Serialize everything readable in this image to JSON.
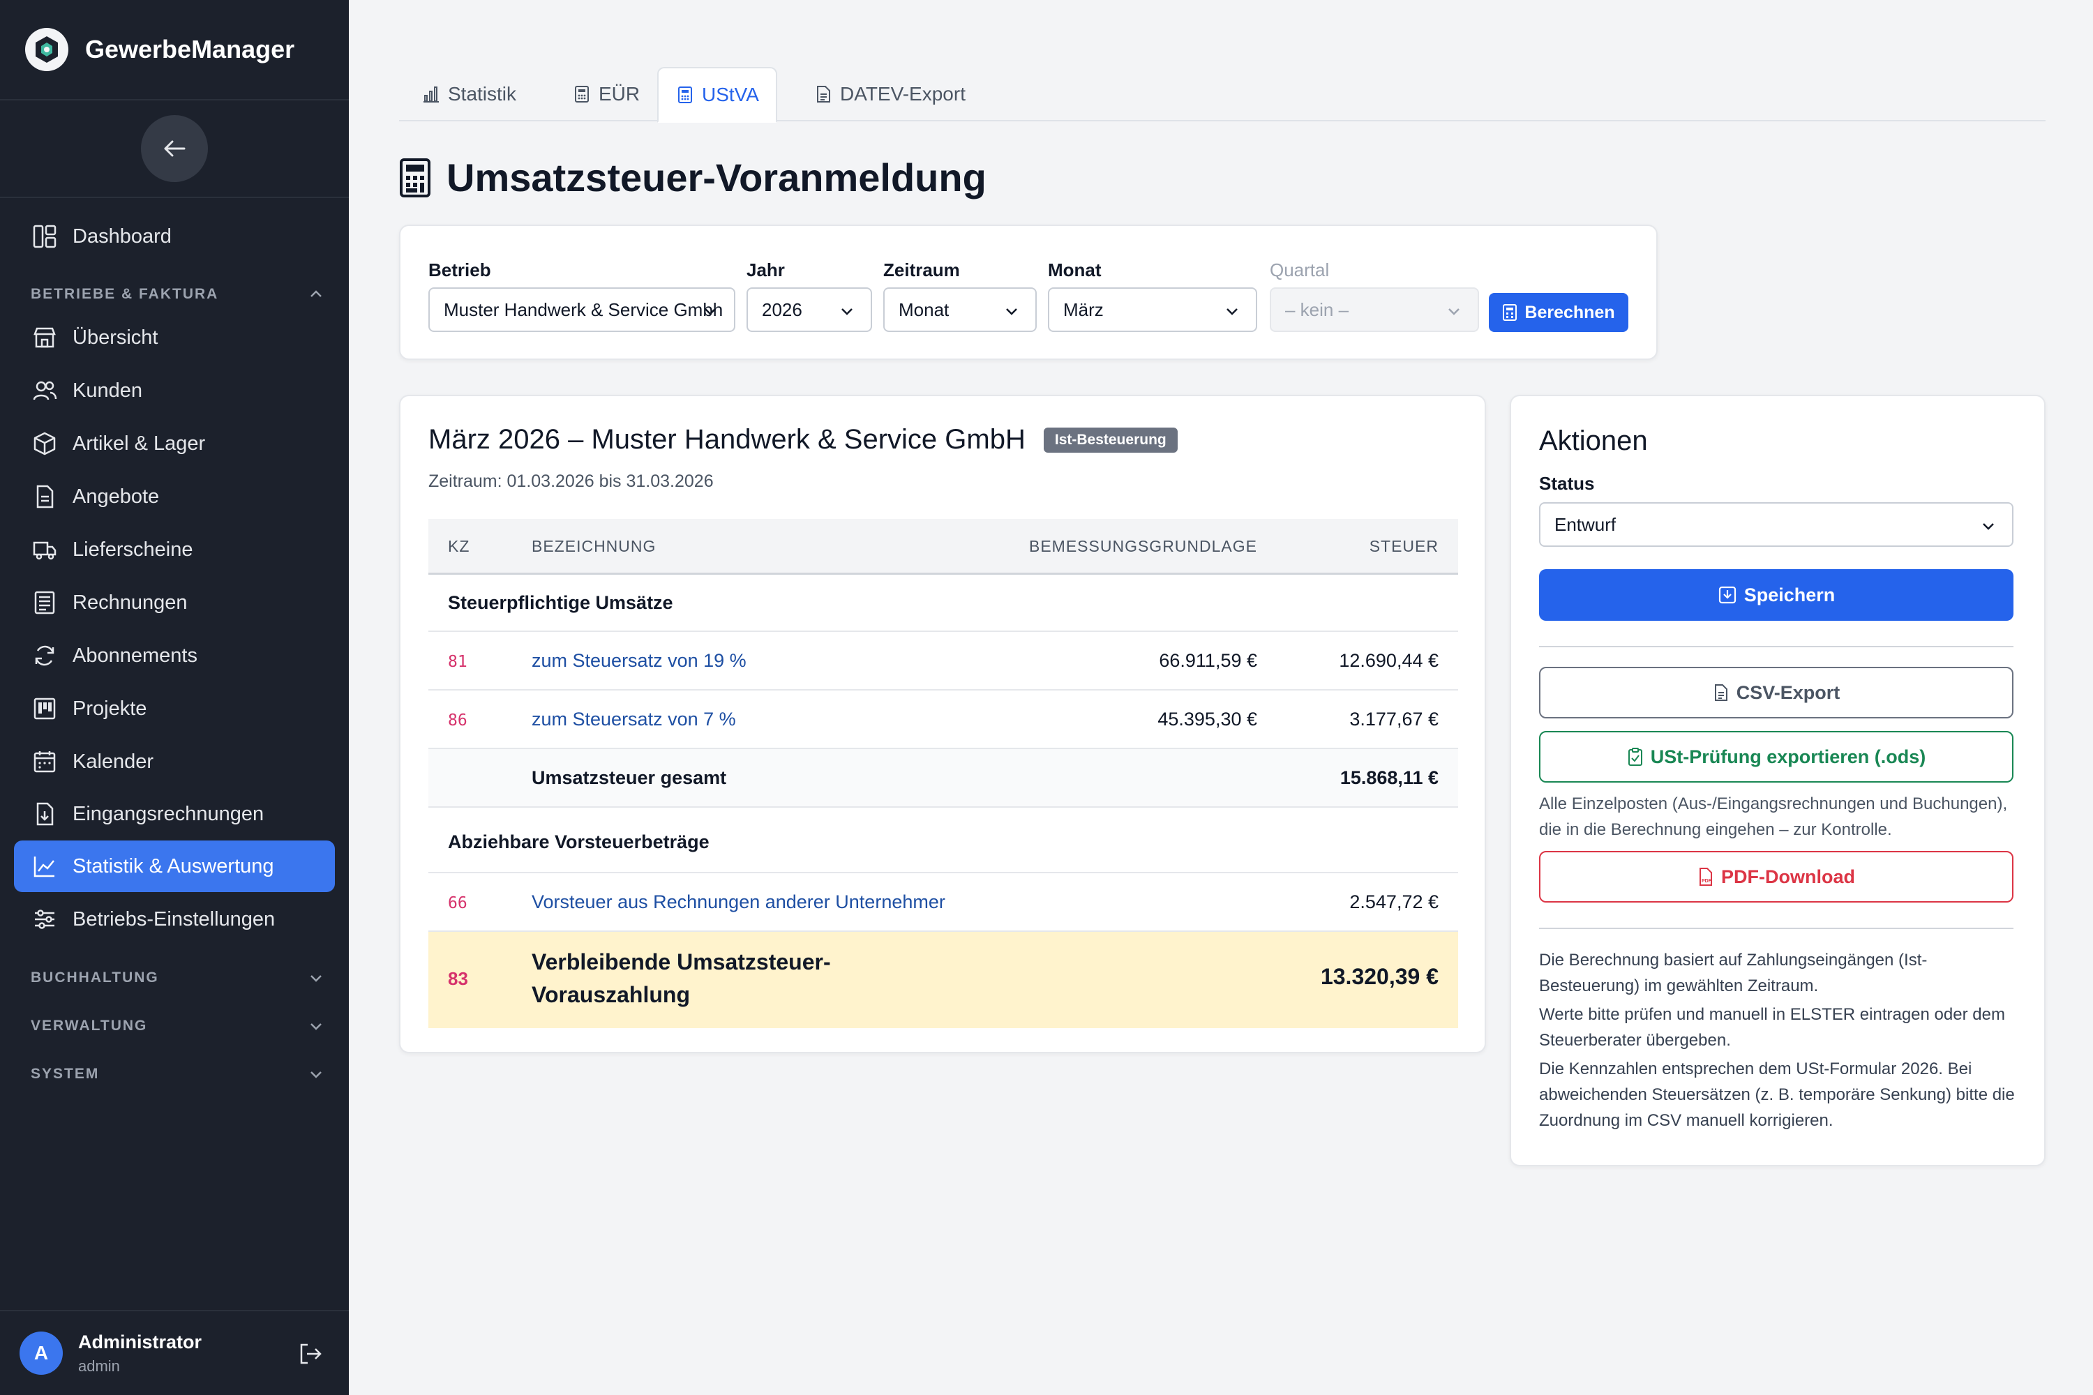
{
  "app": {
    "name": "GewerbeManager"
  },
  "sidebar": {
    "items": [
      {
        "label": "Dashboard"
      },
      {
        "label": "Übersicht"
      },
      {
        "label": "Kunden"
      },
      {
        "label": "Artikel & Lager"
      },
      {
        "label": "Angebote"
      },
      {
        "label": "Lieferscheine"
      },
      {
        "label": "Rechnungen"
      },
      {
        "label": "Abonnements"
      },
      {
        "label": "Projekte"
      },
      {
        "label": "Kalender"
      },
      {
        "label": "Eingangsrechnungen"
      },
      {
        "label": "Statistik & Auswertung",
        "active": true
      },
      {
        "label": "Betriebs-Einstellungen"
      }
    ],
    "sections": [
      {
        "label": "BETRIEBE & FAKTURA",
        "expanded": true
      },
      {
        "label": "BUCHHALTUNG",
        "expanded": false
      },
      {
        "label": "VERWALTUNG",
        "expanded": false
      },
      {
        "label": "SYSTEM",
        "expanded": false
      }
    ],
    "user": {
      "initial": "A",
      "name": "Administrator",
      "role": "admin"
    }
  },
  "tabs": [
    {
      "label": "Statistik",
      "icon": "bar-chart-icon"
    },
    {
      "label": "EÜR",
      "icon": "calculator-icon"
    },
    {
      "label": "UStVA",
      "icon": "calculator-icon",
      "active": true
    },
    {
      "label": "DATEV-Export",
      "icon": "file-icon"
    }
  ],
  "page": {
    "title": "Umsatzsteuer-Voranmeldung"
  },
  "filters": {
    "betrieb": {
      "label": "Betrieb",
      "value": "Muster Handwerk & Service Gmbh"
    },
    "jahr": {
      "label": "Jahr",
      "value": "2026"
    },
    "zeitraum": {
      "label": "Zeitraum",
      "value": "Monat"
    },
    "monat": {
      "label": "Monat",
      "value": "März"
    },
    "quartal": {
      "label": "Quartal",
      "value": "– kein –",
      "disabled": true
    },
    "calc_button": "Berechnen"
  },
  "report": {
    "title": "März 2026 – Muster Handwerk & Service GmbH",
    "badge": "Ist-Besteuerung",
    "period": "Zeitraum: 01.03.2026 bis 31.03.2026",
    "headers": {
      "kz": "KZ",
      "bezeichnung": "BEZEICHNUNG",
      "bemessung": "BEMESSUNGSGRUNDLAGE",
      "steuer": "STEUER"
    },
    "section_umsaetze": "Steuerpflichtige Umsätze",
    "rows_umsaetze": [
      {
        "kz": "81",
        "bezeichnung": "zum Steuersatz von 19 %",
        "bemessung": "66.911,59 €",
        "steuer": "12.690,44 €"
      },
      {
        "kz": "86",
        "bezeichnung": "zum Steuersatz von 7 %",
        "bemessung": "45.395,30 €",
        "steuer": "3.177,67 €"
      }
    ],
    "total_umsatzsteuer": {
      "label": "Umsatzsteuer gesamt",
      "steuer": "15.868,11 €"
    },
    "section_vorsteuer": "Abziehbare Vorsteuerbeträge",
    "rows_vorsteuer": [
      {
        "kz": "66",
        "bezeichnung": "Vorsteuer aus Rechnungen anderer Unternehmer",
        "bemessung": "",
        "steuer": "2.547,72 €"
      }
    ],
    "final": {
      "kz": "83",
      "label_line1": "Verbleibende Umsatzsteuer-",
      "label_line2": "Vorauszahlung",
      "steuer": "13.320,39 €"
    }
  },
  "actions": {
    "title": "Aktionen",
    "status_label": "Status",
    "status_value": "Entwurf",
    "save": "Speichern",
    "csv_export": "CSV-Export",
    "ust_export": "USt-Prüfung exportieren (.ods)",
    "ust_hint": "Alle Einzelposten (Aus-/Eingangsrechnungen und Buchungen), die in die Berechnung eingehen – zur Kontrolle.",
    "pdf": "PDF-Download",
    "notes": [
      "Die Berechnung basiert auf Zahlungseingängen (Ist-Besteuerung) im gewählten Zeitraum.",
      "Werte bitte prüfen und manuell in ELSTER eintragen oder dem Steuerberater übergeben.",
      "Die Kennzahlen entsprechen dem USt-Formular 2026. Bei abweichenden Steuersätzen (z. B. temporäre Senkung) bitte die Zuordnung im CSV manuell korrigieren."
    ]
  },
  "colors": {
    "sidebar_bg": "#1c212c",
    "accent": "#2563eb",
    "active_nav": "#3b76ee",
    "final_row": "#fff3cd"
  }
}
